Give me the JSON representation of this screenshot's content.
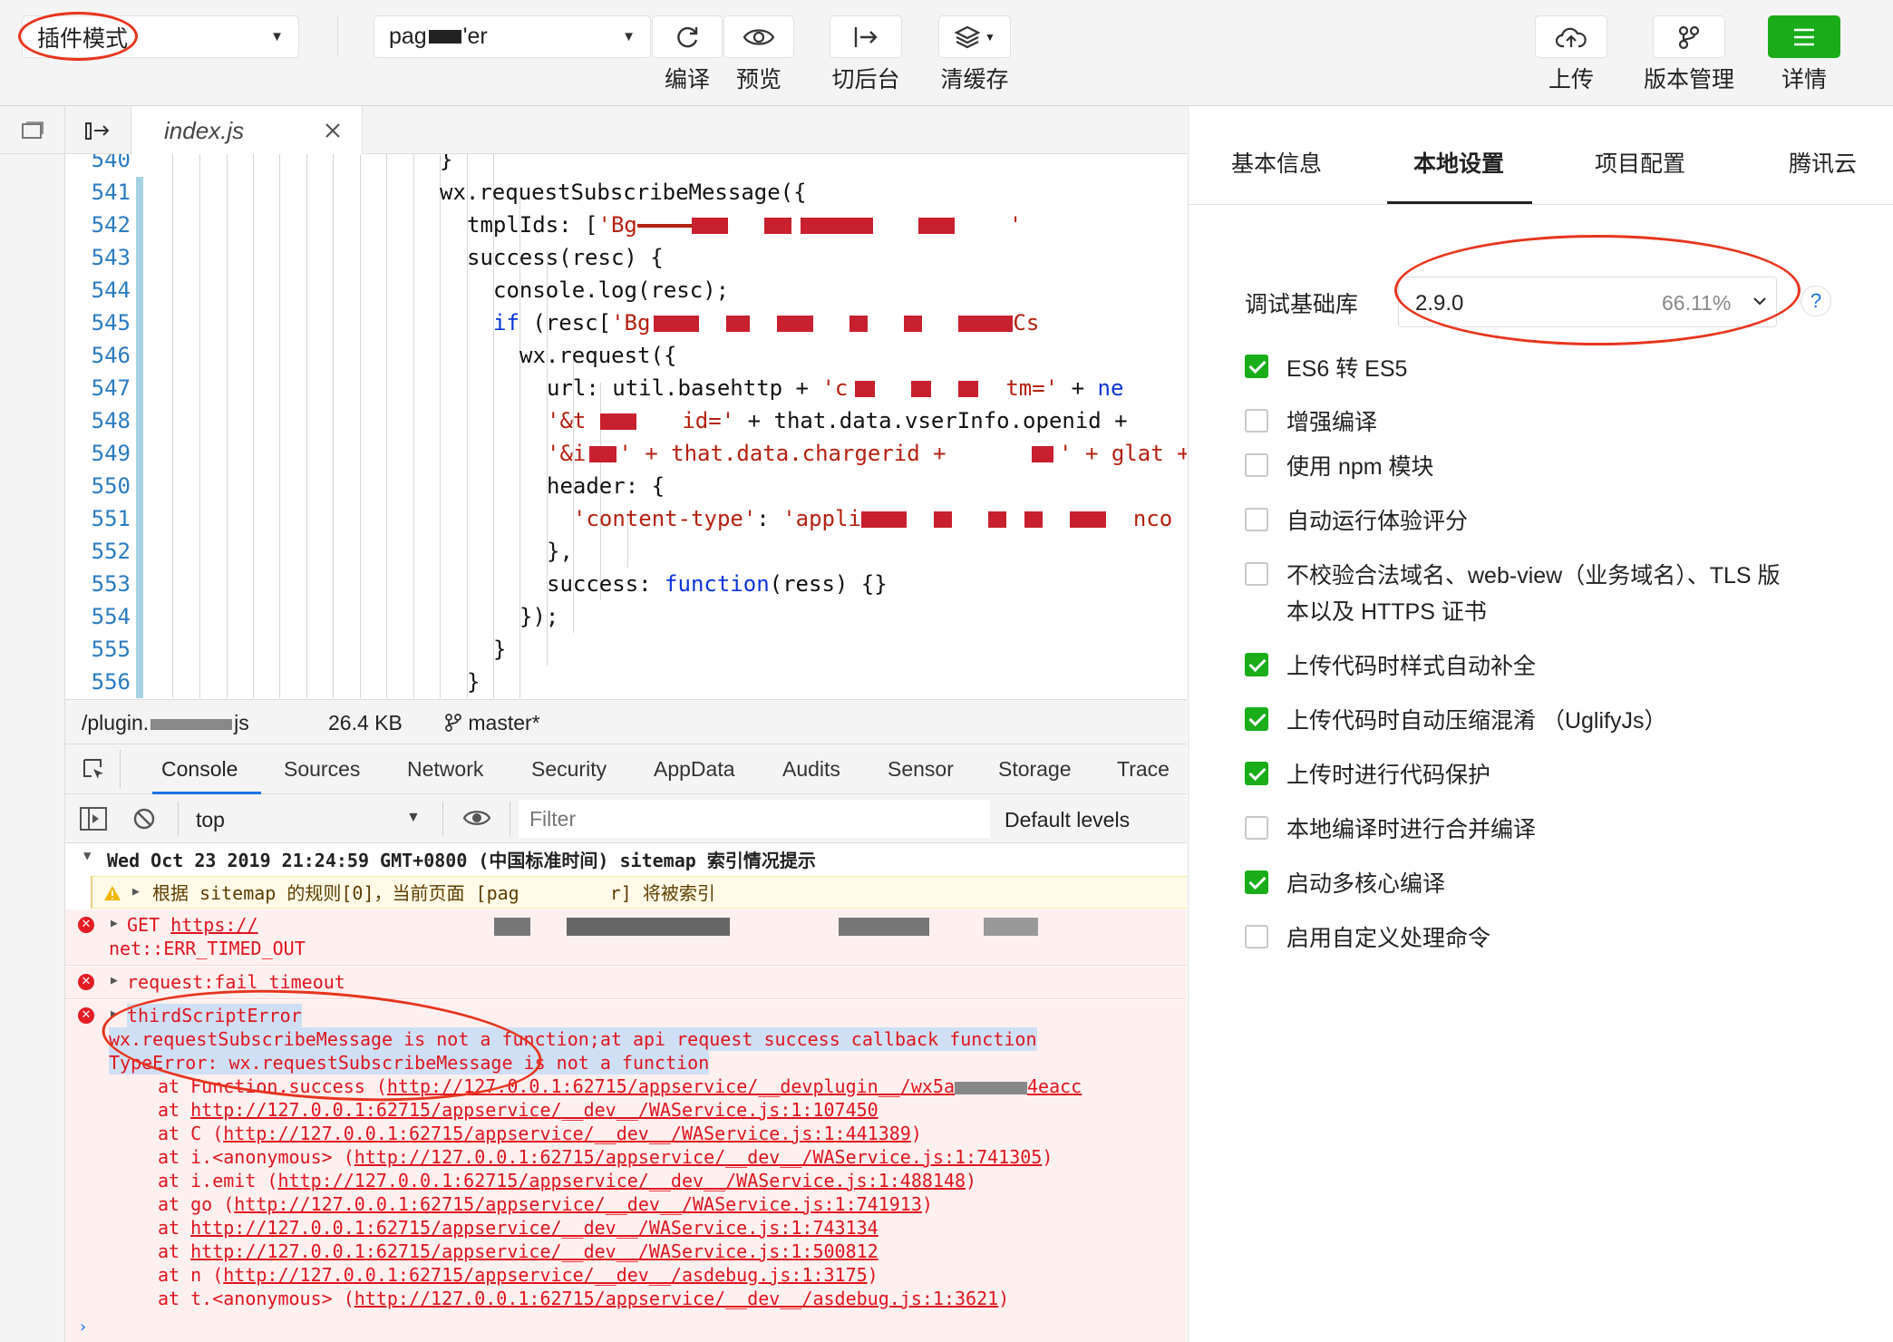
{
  "toolbar": {
    "mode": "插件模式",
    "page": "pag",
    "page_tail": "'er",
    "buttons": [
      {
        "label": "编译",
        "icon": "refresh-icon"
      },
      {
        "label": "预览",
        "icon": "eye-icon"
      },
      {
        "label": "切后台",
        "icon": "switch-background-icon"
      },
      {
        "label": "清缓存",
        "icon": "layers-icon"
      }
    ],
    "right_buttons": [
      {
        "label": "上传",
        "icon": "cloud-upload-icon"
      },
      {
        "label": "版本管理",
        "icon": "branch-icon"
      },
      {
        "label": "详情",
        "icon": "menu-icon"
      }
    ],
    "detail_color": "#1aad19"
  },
  "editor": {
    "tab": "index.js",
    "code": {
      "l540": "}",
      "l541": "wx.requestSubscribeMessage({",
      "l542a": "tmplIds: [",
      "l542b": "'Bg",
      "l542c": "'",
      "l543": "success(resc) {",
      "l544": "console.log(resc);",
      "l545a": "if",
      "l545b": " (resc[",
      "l545c": "'Bg",
      "l545d": "Cs",
      "l546": "wx.request({",
      "l547a": "url: util.basehttp + ",
      "l547b": "'c",
      "l547c": "tm='",
      "l547d": " + ",
      "l547e": "ne",
      "l548a": "'&t",
      "l548b": "id='",
      "l548c": " + that.data.vserInfo.openid +",
      "l549a": "'&i",
      "l549b": "' + that.data.chargerid + ",
      "l549c": "' + glat + ",
      "l549d": "'",
      "l550": "header: {",
      "l551a": "'content-type'",
      "l551b": ": ",
      "l551c": "'appli",
      "l551d": "nco",
      "l552": "},",
      "l553a": "success: ",
      "l553b": "function",
      "l553c": "(ress) {}",
      "l554": "});",
      "l555": "}",
      "l556": "}"
    },
    "line_numbers": [
      "540",
      "541",
      "542",
      "543",
      "544",
      "545",
      "546",
      "547",
      "548",
      "549",
      "550",
      "551",
      "552",
      "553",
      "554",
      "555",
      "556"
    ]
  },
  "filebar": {
    "path": "/plugin.",
    "path_tail": "js",
    "size": "26.4 KB",
    "branch": "master*"
  },
  "devtools": {
    "tabs": [
      "Console",
      "Sources",
      "Network",
      "Security",
      "AppData",
      "Audits",
      "Sensor",
      "Storage",
      "Trace"
    ],
    "context": "top",
    "filter_placeholder": "Filter",
    "levels": "Default levels"
  },
  "console": {
    "group_header": "Wed Oct 23 2019 21:24:59 GMT+0800 (中国标准时间) sitemap 索引情况提示",
    "warn_a": "根据 sitemap 的规则[0]，当前页面 [pag",
    "warn_b": "r] 将被索引",
    "get_prefix": "GET ",
    "get_url": "https://",
    "get_error": "net::ERR_TIMED_OUT",
    "request_fail": "request:fail timeout",
    "third_error": "thirdScriptError",
    "msg_line": "wx.requestSubscribeMessage is not a function;at api request success callback function",
    "type_error": "TypeError: wx.requestSubscribeMessage is not a function",
    "stack0_a": "at Function.success (",
    "stack0_b": "http://127.0.0.1:62715/appservice/__devplugin__/wx5a",
    "stack0_c": "4eacc",
    "stack": [
      {
        "pre": "at ",
        "url": "http://127.0.0.1:62715/appservice/__dev__/WAService.js:1:107450",
        "post": ""
      },
      {
        "pre": "at C (",
        "url": "http://127.0.0.1:62715/appservice/__dev__/WAService.js:1:441389",
        "post": ")"
      },
      {
        "pre": "at i.<anonymous> (",
        "url": "http://127.0.0.1:62715/appservice/__dev__/WAService.js:1:741305",
        "post": ")"
      },
      {
        "pre": "at i.emit (",
        "url": "http://127.0.0.1:62715/appservice/__dev__/WAService.js:1:488148",
        "post": ")"
      },
      {
        "pre": "at go (",
        "url": "http://127.0.0.1:62715/appservice/__dev__/WAService.js:1:741913",
        "post": ")"
      },
      {
        "pre": "at ",
        "url": "http://127.0.0.1:62715/appservice/__dev__/WAService.js:1:743134",
        "post": ""
      },
      {
        "pre": "at ",
        "url": "http://127.0.0.1:62715/appservice/__dev__/WAService.js:1:500812",
        "post": ""
      },
      {
        "pre": "at n (",
        "url": "http://127.0.0.1:62715/appservice/__dev__/asdebug.js:1:3175",
        "post": ")"
      },
      {
        "pre": "at t.<anonymous> (",
        "url": "http://127.0.0.1:62715/appservice/__dev__/asdebug.js:1:3621",
        "post": ")"
      }
    ]
  },
  "settings": {
    "tabs": [
      "基本信息",
      "本地设置",
      "项目配置",
      "腾讯云"
    ],
    "lib_label": "调试基础库",
    "lib_version": "2.9.0",
    "lib_percent": "66.11%",
    "help": "?",
    "options": [
      {
        "label": "ES6 转 ES5",
        "checked": true
      },
      {
        "label": "增强编译",
        "checked": false
      },
      {
        "label": "使用 npm 模块",
        "checked": false
      },
      {
        "label": "自动运行体验评分",
        "checked": false
      },
      {
        "label": "不校验合法域名、web-view（业务域名）、TLS 版",
        "label2": "本以及 HTTPS 证书",
        "checked": false
      },
      {
        "label": "上传代码时样式自动补全",
        "checked": true
      },
      {
        "label": "上传代码时自动压缩混淆 （UglifyJs）",
        "checked": true
      },
      {
        "label": "上传时进行代码保护",
        "checked": true
      },
      {
        "label": "本地编译时进行合并编译",
        "checked": false
      },
      {
        "label": "启动多核心编译",
        "checked": true
      },
      {
        "label": "启用自定义处理命令",
        "checked": false
      }
    ]
  }
}
